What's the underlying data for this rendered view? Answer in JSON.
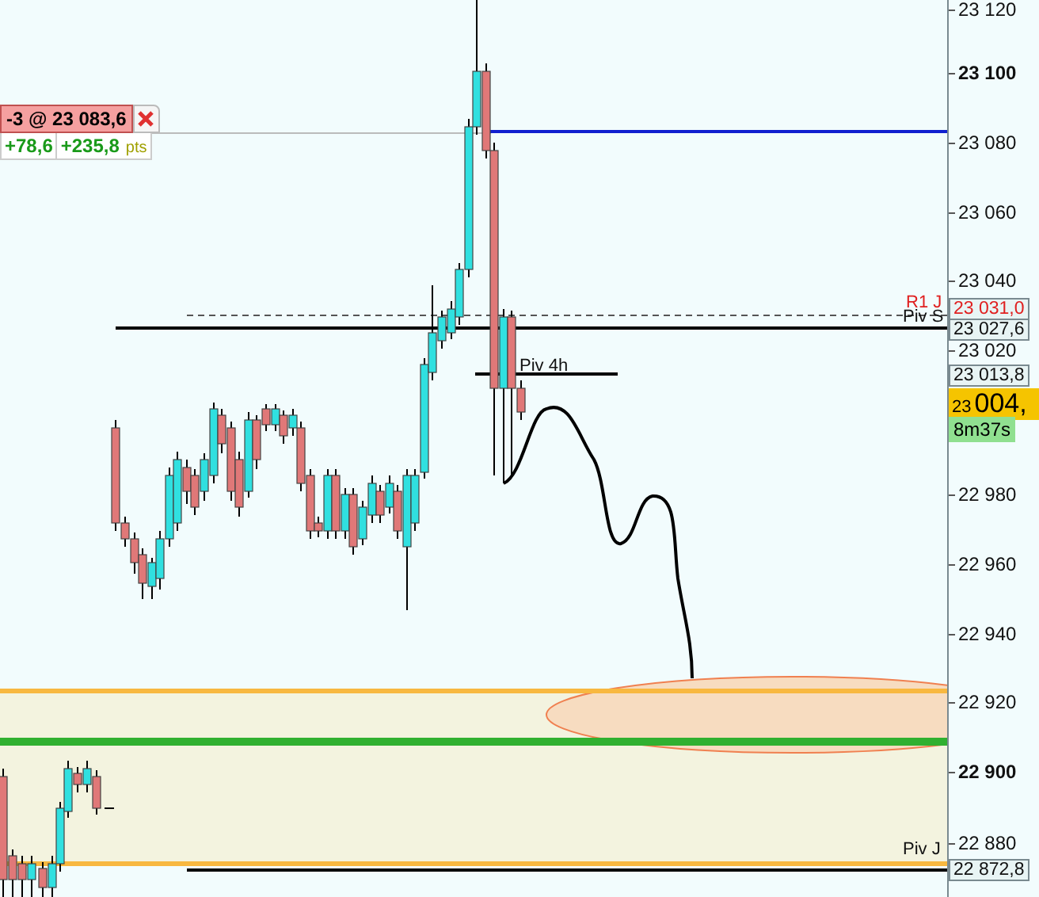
{
  "order_tag": {
    "text": "-3 @ 23 083,6"
  },
  "pnl": {
    "points": "+78,6",
    "total": "+235,8",
    "unit": "pts"
  },
  "line_labels": [
    {
      "kind": "resistance",
      "text": "R1 J"
    },
    {
      "kind": "pivot",
      "text": "Piv S"
    },
    {
      "kind": "pivot",
      "text": "Piv 4h"
    },
    {
      "kind": "pivot",
      "text": "Piv J"
    }
  ],
  "axis_ticks": [
    {
      "label": "23 120",
      "major": false
    },
    {
      "label": "23 100",
      "major": true
    },
    {
      "label": "23 080",
      "major": false
    },
    {
      "label": "23 060",
      "major": false
    },
    {
      "label": "23 040",
      "major": false
    },
    {
      "label": "23 020",
      "major": false
    },
    {
      "label": "22 980",
      "major": false
    },
    {
      "label": "22 960",
      "major": false
    },
    {
      "label": "22 940",
      "major": false
    },
    {
      "label": "22 920",
      "major": false
    },
    {
      "label": "22 900",
      "major": true
    },
    {
      "label": "22 880",
      "major": false
    }
  ],
  "price_tags": [
    {
      "kind": "resistance",
      "text": "23 031,0"
    },
    {
      "kind": "level",
      "text": "23 027,6"
    },
    {
      "kind": "level",
      "text": "23 013,8"
    },
    {
      "kind": "level",
      "text": "22 872,8"
    }
  ],
  "current_price": {
    "small": "23",
    "big": "004,",
    "timer": "8m37s"
  }
}
